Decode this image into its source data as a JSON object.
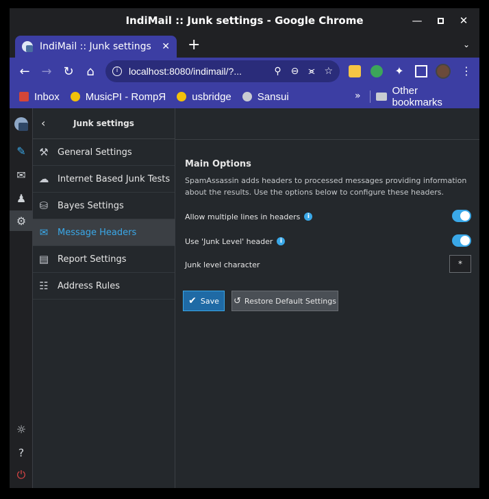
{
  "window": {
    "title": "IndiMail :: Junk settings - Google Chrome"
  },
  "tab": {
    "title": "IndiMail :: Junk settings",
    "close": "✕",
    "new_tab": "+"
  },
  "omnibox": {
    "url": "localhost:8080/indimail/?..."
  },
  "bookmarks": {
    "items": [
      {
        "label": "Inbox",
        "icon": "gmail-icon"
      },
      {
        "label": "MusicPI - RompЯ",
        "icon": "play-icon"
      },
      {
        "label": "usbridge",
        "icon": "play-icon"
      },
      {
        "label": "Sansui",
        "icon": "globe-icon"
      }
    ],
    "more": "»",
    "other": "Other bookmarks"
  },
  "sidebar": {
    "back": "‹",
    "title": "Junk settings",
    "items": [
      {
        "label": "General Settings",
        "icon": "wrench-icon",
        "active": false
      },
      {
        "label": "Internet Based Junk Tests",
        "icon": "cloud-icon",
        "active": false
      },
      {
        "label": "Bayes Settings",
        "icon": "database-icon",
        "active": false
      },
      {
        "label": "Message Headers",
        "icon": "envelope-icon",
        "active": true
      },
      {
        "label": "Report Settings",
        "icon": "document-icon",
        "active": false
      },
      {
        "label": "Address Rules",
        "icon": "address-card-icon",
        "active": false
      }
    ]
  },
  "main": {
    "section_title": "Main Options",
    "description": "SpamAssassin adds headers to processed messages providing information about the results. Use the options below to configure these headers.",
    "options": [
      {
        "label": "Allow multiple lines in headers",
        "help": "i",
        "enabled": true
      },
      {
        "label": "Use 'Junk Level' header",
        "help": "i",
        "enabled": true
      }
    ],
    "junk_char_label": "Junk level character",
    "junk_char_value": "*",
    "save_label": "Save",
    "restore_label": "Restore Default Settings"
  },
  "colors": {
    "accent": "#3aa8e8",
    "chrome_theme": "#3c3ea3",
    "logout": "#e04646"
  }
}
